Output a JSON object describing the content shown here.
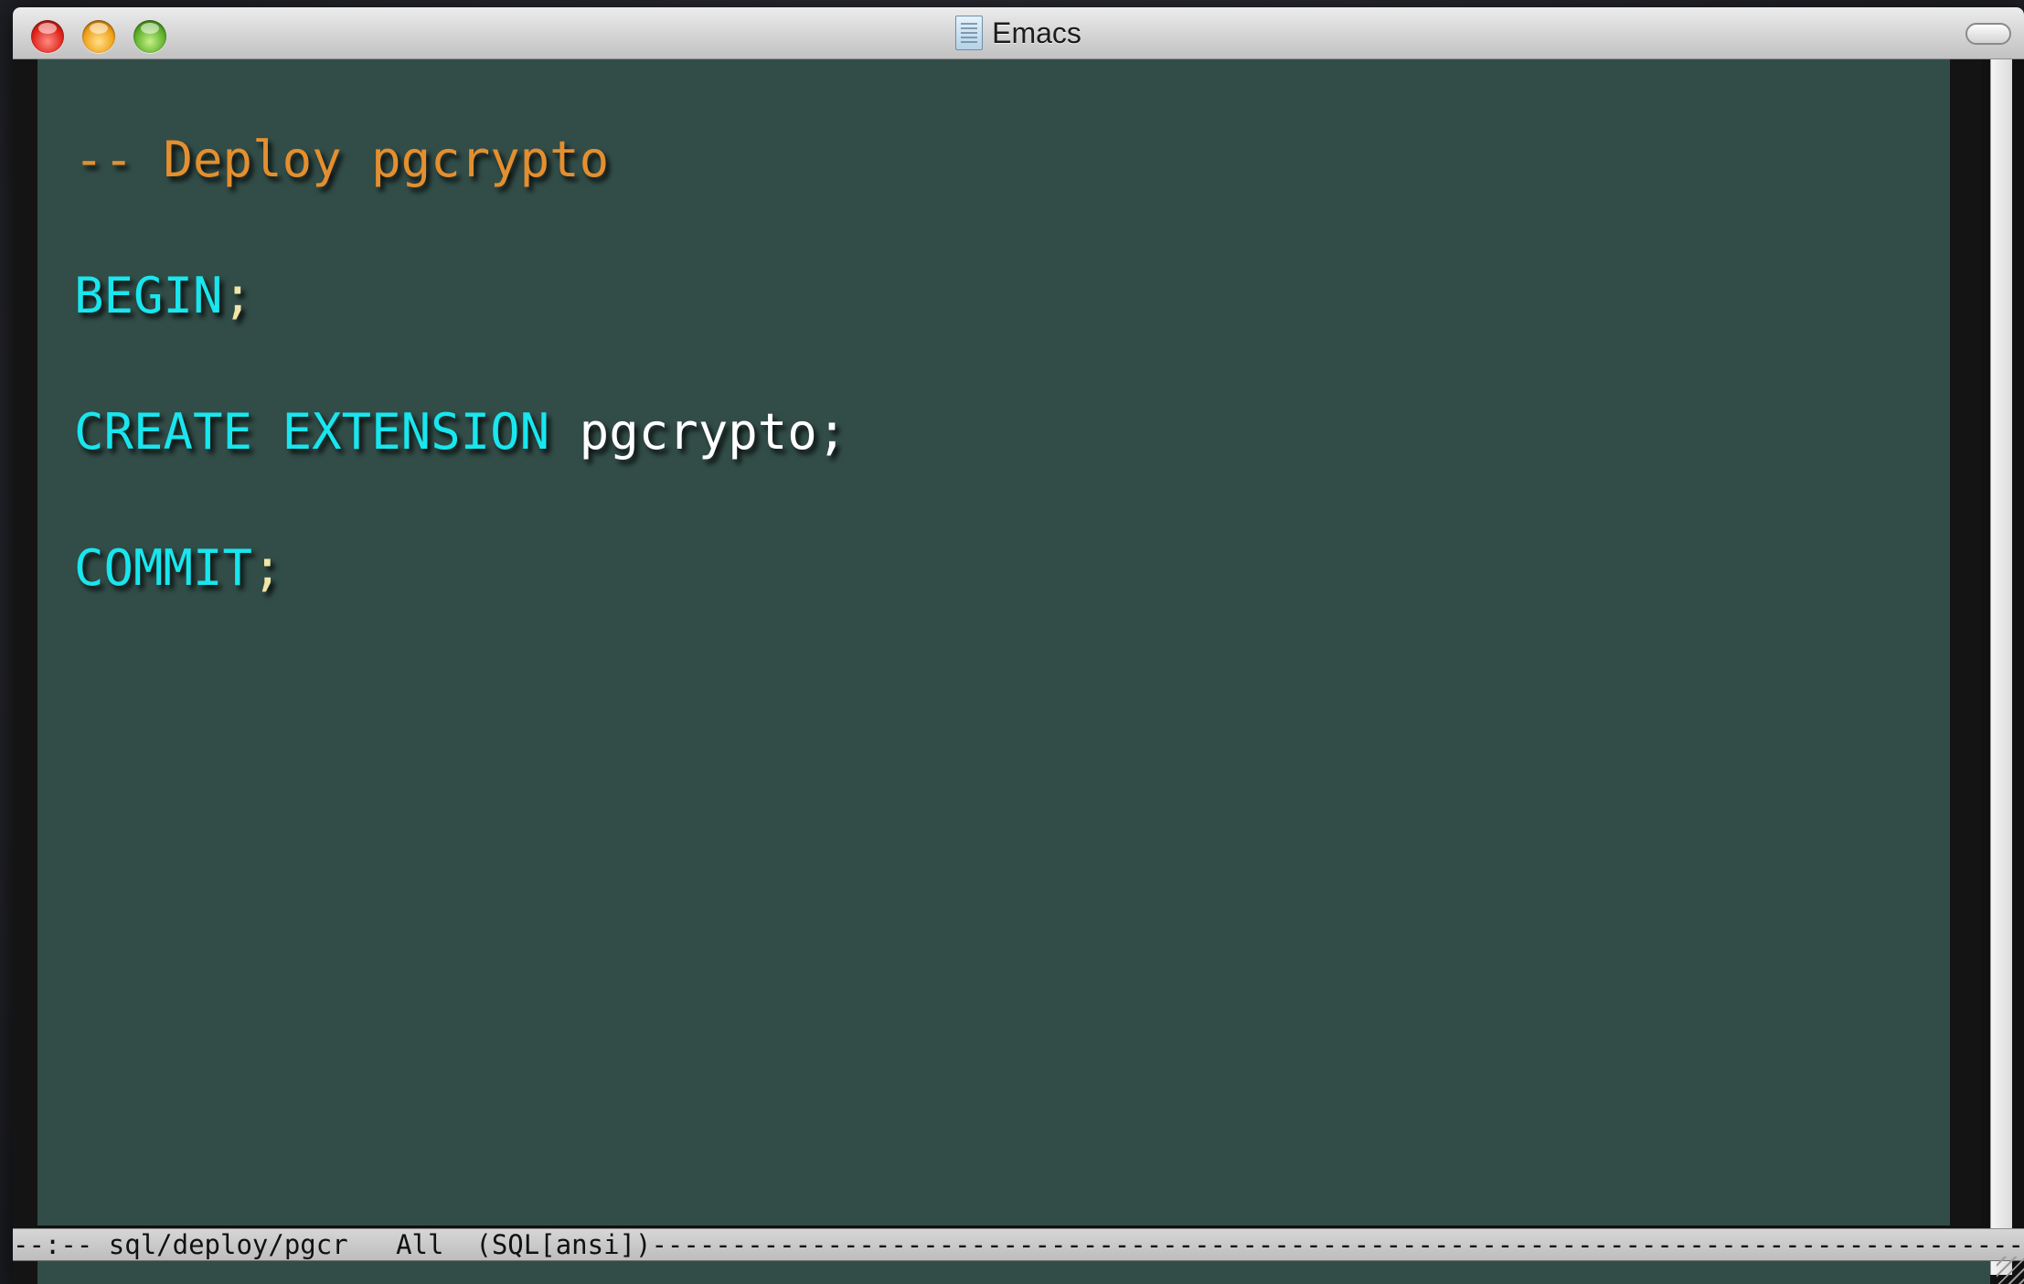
{
  "window": {
    "title": "Emacs",
    "title_icon": "document-icon"
  },
  "controls": {
    "close": "close-icon",
    "minimize": "minimize-icon",
    "zoom": "zoom-icon"
  },
  "buffer": {
    "lines": [
      {
        "tokens": [
          {
            "text": "-- Deploy pgcrypto",
            "kind": "comment"
          }
        ]
      },
      {
        "tokens": [
          {
            "text": "BEGIN",
            "kind": "keyword"
          },
          {
            "text": ";",
            "kind": "punct"
          }
        ]
      },
      {
        "tokens": [
          {
            "text": "CREATE EXTENSION",
            "kind": "keyword"
          },
          {
            "text": " pgcrypto;",
            "kind": "plain"
          }
        ]
      },
      {
        "tokens": [
          {
            "text": "COMMIT",
            "kind": "keyword"
          },
          {
            "text": ";",
            "kind": "punct"
          }
        ]
      }
    ]
  },
  "modeline": {
    "status": "--:--",
    "buffer_name": "sql/deploy/pgcr",
    "position": "All",
    "mode": "(SQL[ansi])",
    "filler": "------------------------------------------------------------------------------------------------------------------------------------------------"
  },
  "colors": {
    "background": "#324d48",
    "comment": "#e48f2f",
    "keyword": "#19e6ee",
    "plain": "#ffffff",
    "punct": "#f1e6a8"
  }
}
